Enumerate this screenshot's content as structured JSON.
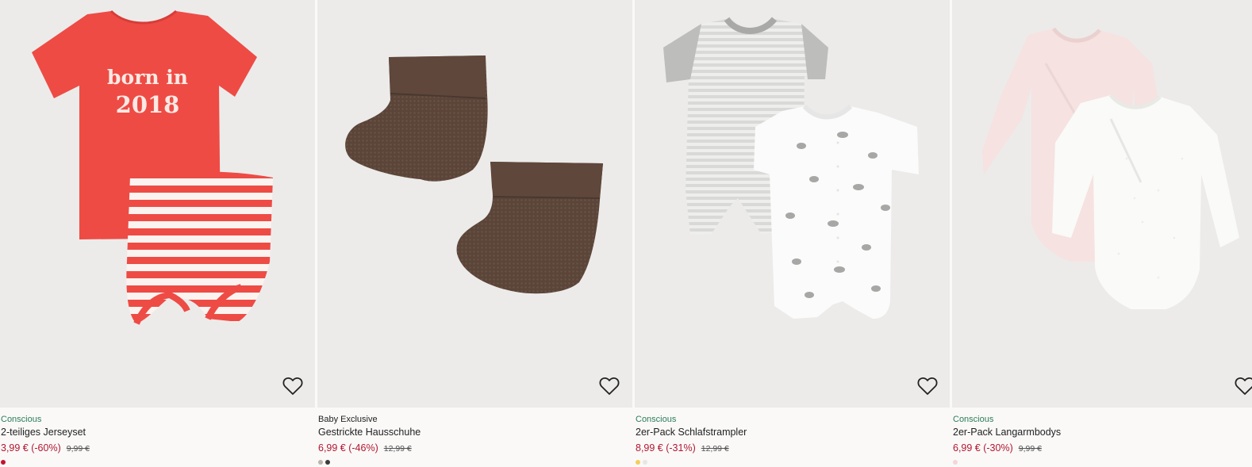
{
  "products": [
    {
      "brand": "Conscious",
      "title": "2-teiliges Jerseyset",
      "price": "3,99 € (-60%)",
      "old_price": "9,99 €",
      "image_icon": "baby-shirt-and-shorts-image",
      "shirt_print": [
        "born in",
        "2018"
      ],
      "swatch_colors": [
        "#c8102e"
      ]
    },
    {
      "brand": "Baby Exclusive",
      "title": "Gestrickte Hausschuhe",
      "price": "6,99 € (-46%)",
      "old_price": "12,99 €",
      "image_icon": "knitted-booties-image",
      "swatch_colors": [
        "#b9b4ad",
        "#3b3b3b"
      ]
    },
    {
      "brand": "Conscious",
      "title": "2er-Pack Schlafstrampler",
      "price": "8,99 € (-31%)",
      "old_price": "12,99 €",
      "image_icon": "sleep-rompers-image",
      "swatch_colors": [
        "#f2cf5b",
        "#e8e6e3"
      ]
    },
    {
      "brand": "Conscious",
      "title": "2er-Pack Langarmbodys",
      "price": "6,99 € (-30%)",
      "old_price": "9,99 €",
      "image_icon": "long-sleeve-bodysuits-image",
      "swatch_colors": [
        "#f3d6d6"
      ]
    }
  ],
  "favorite_icon": "heart-outline-icon",
  "colors": {
    "brand_conscious": "#2b7d5a",
    "sale_price": "#b3162f",
    "image_background": "#ecebea",
    "page_background": "#faf9f8"
  }
}
